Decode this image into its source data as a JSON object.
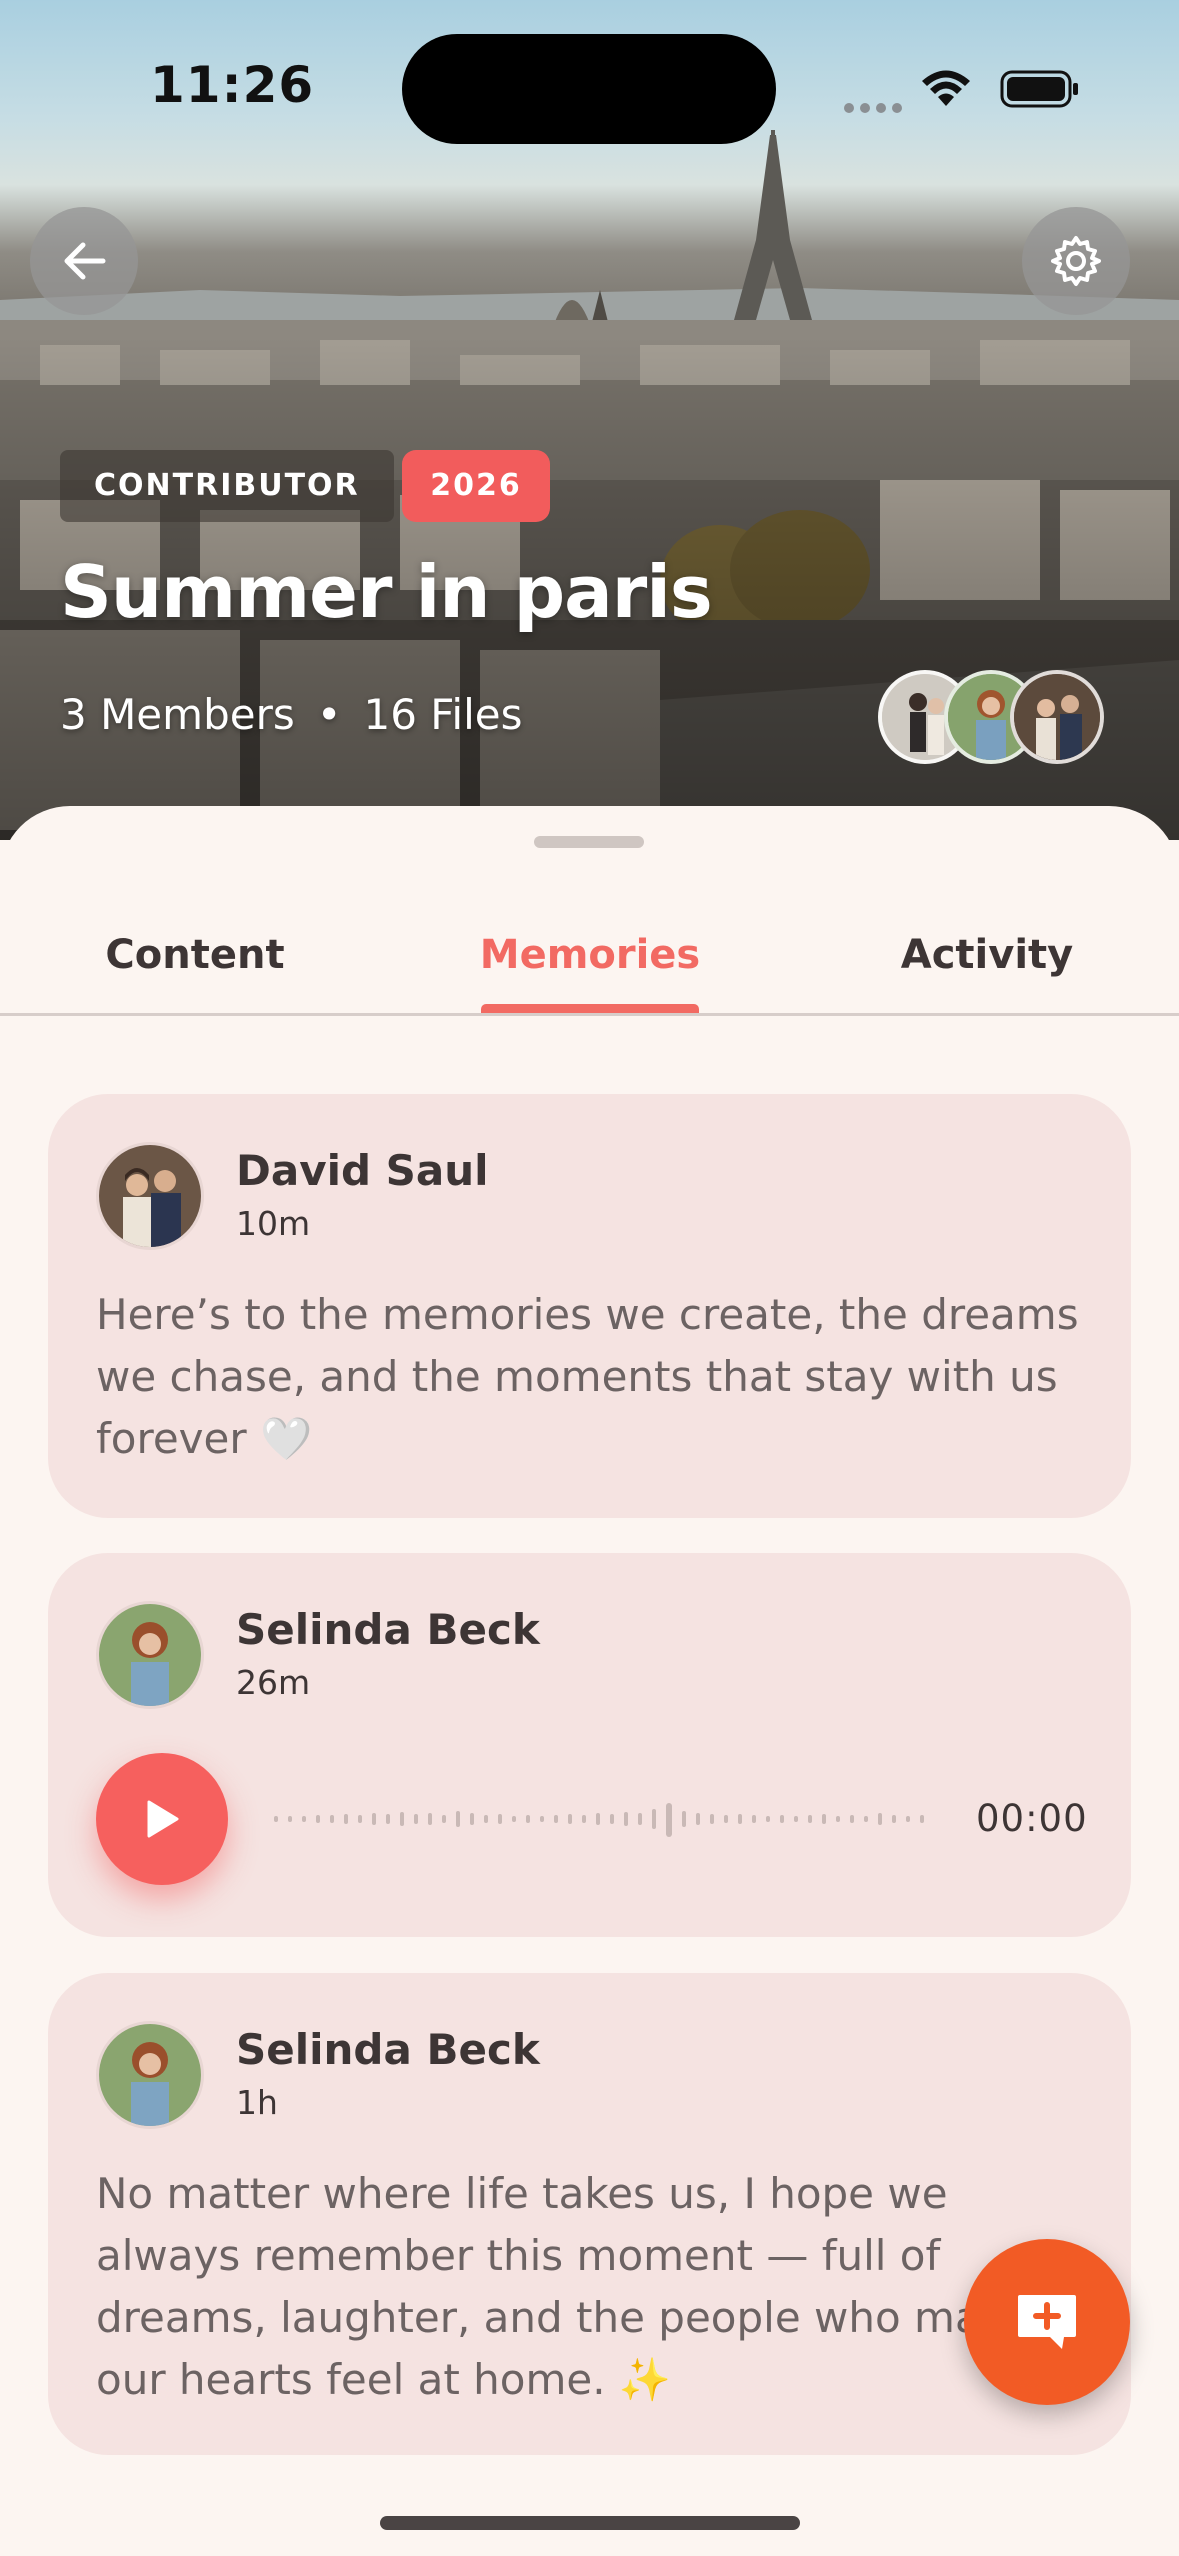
{
  "status_bar": {
    "time": "11:26"
  },
  "album": {
    "role_badge": "CONTRIBUTOR",
    "year_badge": "2026",
    "title": "Summer in paris",
    "members": "3 Members",
    "separator": "•",
    "files": "16 Files"
  },
  "tabs": [
    {
      "label": "Content",
      "active": false
    },
    {
      "label": "Memories",
      "active": true
    },
    {
      "label": "Activity",
      "active": false
    }
  ],
  "memories": [
    {
      "author": "David Saul",
      "time": "10m",
      "type": "text",
      "text": "Here’s to the memories we create, the dreams we chase, and the moments that stay with us forever 🤍"
    },
    {
      "author": "Selinda Beck",
      "time": "26m",
      "type": "audio",
      "duration": "00:00"
    },
    {
      "author": "Selinda Beck",
      "time": "1h",
      "type": "text",
      "text": "No matter where life takes us, I hope we always remember this moment — full of dreams, laughter, and the people who make our hearts feel at home. ✨"
    }
  ],
  "icons": {
    "back": "arrow-left-icon",
    "settings": "gear-icon",
    "play": "play-icon",
    "fab": "add-comment-icon"
  },
  "colors": {
    "accent": "#f26a63",
    "fab": "#f25b25",
    "card_bg": "#f5e3e1",
    "sheet_bg": "#fcf5f1",
    "year_badge": "#f25c5c"
  }
}
